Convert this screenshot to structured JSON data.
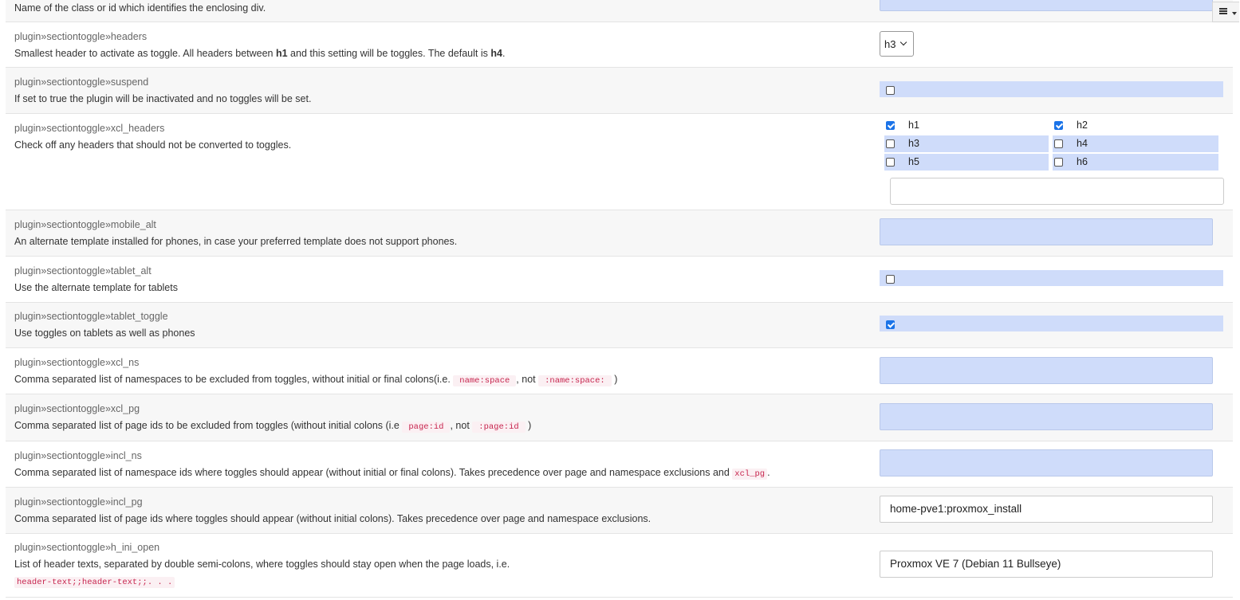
{
  "top_row": {
    "description": "Name of the class or id which identifies the enclosing div."
  },
  "settings": [
    {
      "key": "plugin»sectiontoggle»headers",
      "desc_parts": [
        "Smallest header to activate as toggle. All headers between ",
        "h1",
        " and this setting will be toggles. The default is ",
        "h4",
        "."
      ],
      "select_value": "h3"
    },
    {
      "key": "plugin»sectiontoggle»suspend",
      "description": "If set to true the plugin will be inactivated and no toggles will be set.",
      "checked": false
    },
    {
      "key": "plugin»sectiontoggle»xcl_headers",
      "description": "Check off any headers that should not be converted to toggles.",
      "options": [
        {
          "label": "h1",
          "checked": true
        },
        {
          "label": "h2",
          "checked": true
        },
        {
          "label": "h3",
          "checked": false
        },
        {
          "label": "h4",
          "checked": false
        },
        {
          "label": "h5",
          "checked": false
        },
        {
          "label": "h6",
          "checked": false
        }
      ],
      "other_value": ""
    },
    {
      "key": "plugin»sectiontoggle»mobile_alt",
      "description": "An alternate template installed for phones, in case your preferred template does not support phones.",
      "value": ""
    },
    {
      "key": "plugin»sectiontoggle»tablet_alt",
      "description": "Use the alternate template for tablets",
      "checked": false
    },
    {
      "key": "plugin»sectiontoggle»tablet_toggle",
      "description": "Use toggles on tablets as well as phones",
      "checked": true
    },
    {
      "key": "plugin»sectiontoggle»xcl_ns",
      "desc_parts": [
        "Comma separated list of namespaces to be excluded from toggles, without initial or final colons(i.e. ",
        "name:space",
        ", not ",
        ":name:space:",
        " )"
      ],
      "value": ""
    },
    {
      "key": "plugin»sectiontoggle»xcl_pg",
      "desc_parts": [
        "Comma separated list of page ids to be excluded from toggles (without initial colons (i.e ",
        "page:id",
        ", not ",
        ":page:id",
        " )"
      ],
      "value": ""
    },
    {
      "key": "plugin»sectiontoggle»incl_ns",
      "desc_parts": [
        "Comma separated list of namespace ids where toggles should appear (without initial or final colons). Takes precedence over page and namespace exclusions and ",
        "xcl_pg",
        "."
      ],
      "value": ""
    },
    {
      "key": "plugin»sectiontoggle»incl_pg",
      "description": "Comma separated list of page ids where toggles should appear (without initial colons). Takes precedence over page and namespace exclusions.",
      "value": "home-pve1:proxmox_install"
    },
    {
      "key": "plugin»sectiontoggle»h_ini_open",
      "description": "List of header texts, separated by double semi-colons, where toggles should stay open when the page loads, i.e.",
      "code": "header-text;;header-text;;. . .",
      "value": "Proxmox VE 7 (Debian 11 Bullseye)"
    }
  ],
  "icons": {
    "page_tools": "list-icon",
    "page_tools_caret": "caret-down-icon"
  }
}
